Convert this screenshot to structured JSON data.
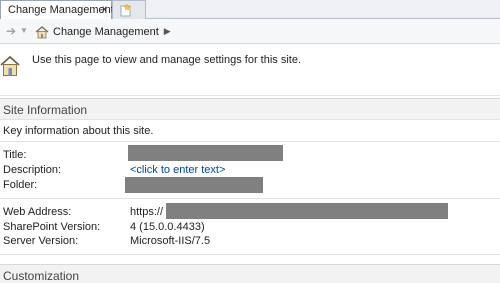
{
  "tabs": [
    {
      "label": "Change Management",
      "close": "x"
    }
  ],
  "breadcrumb": {
    "label": "Change Management"
  },
  "header": {
    "text": "Use this page to view and manage settings for this site."
  },
  "site_info": {
    "title": "Site Information",
    "intro": "Key information about this site.",
    "fields": [
      {
        "label": "Title:",
        "value": ""
      },
      {
        "label": "Description:",
        "value": "<click to enter text>"
      },
      {
        "label": "Folder:",
        "value": ""
      },
      {
        "label": "Web Address:",
        "value": "https://"
      },
      {
        "label": "SharePoint Version:",
        "value": "4 (15.0.0.4433)"
      },
      {
        "label": "Server Version:",
        "value": "Microsoft-IIS/7.5"
      }
    ]
  },
  "customization": {
    "title": "Customization"
  },
  "colors": {
    "link": "#0046a8",
    "redaction": "#808080",
    "band": "#f2f2f2"
  }
}
